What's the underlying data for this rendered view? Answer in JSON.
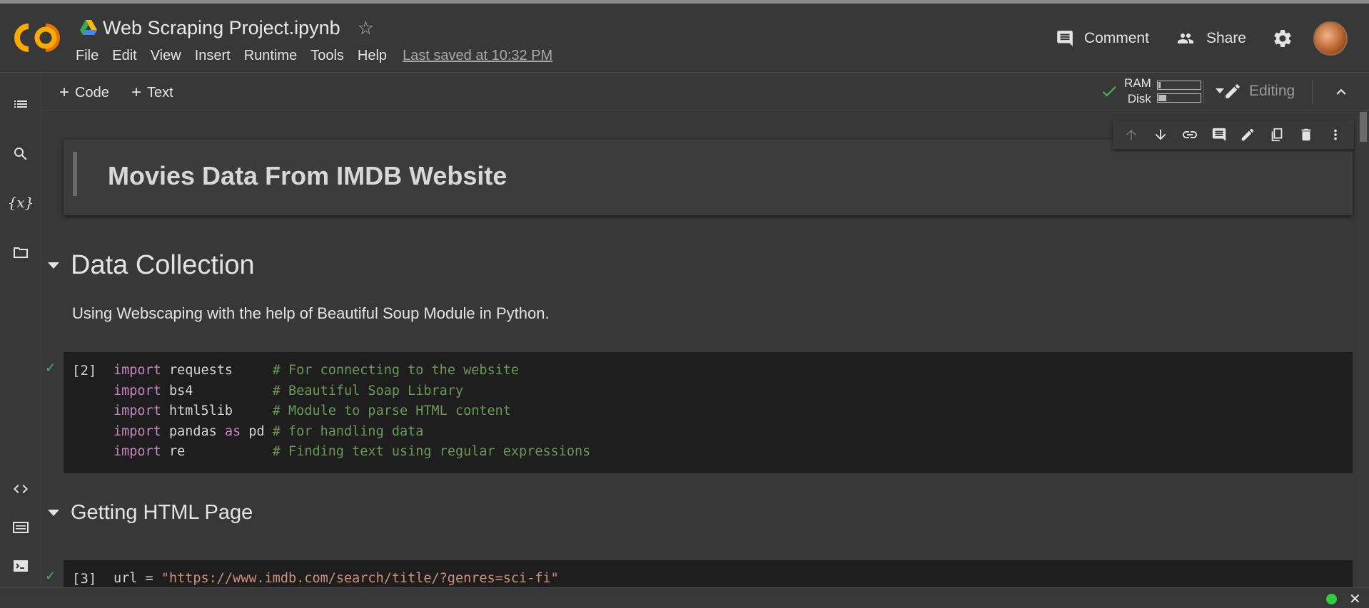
{
  "app": {
    "logo_text": "CO",
    "doc_title": "Web Scraping Project.ipynb",
    "menu": [
      "File",
      "Edit",
      "View",
      "Insert",
      "Runtime",
      "Tools",
      "Help"
    ],
    "last_saved": "Last saved at 10:32 PM"
  },
  "header_actions": {
    "comment_label": "Comment",
    "share_label": "Share"
  },
  "toolbar": {
    "code_label": "Code",
    "text_label": "Text",
    "ram_label": "RAM",
    "disk_label": "Disk",
    "ram_usage": 0.05,
    "disk_usage": 0.18,
    "editing_label": "Editing"
  },
  "rail_icons": [
    "toc-icon",
    "search-icon",
    "variables-icon",
    "folder-icon",
    "code-snippets-icon",
    "command-palette-icon",
    "terminal-icon"
  ],
  "cells": {
    "title": "Movies Data From IMDB Website",
    "section1": "Data Collection",
    "section1_text": "Using Webscaping with the help of Beautiful Soup Module in Python.",
    "cell2_count": "[2]",
    "cell2_lines": [
      {
        "kw": "import",
        "mod": "requests",
        "pad": "     ",
        "comment": "# For connecting to the website"
      },
      {
        "kw": "import",
        "mod": "bs4",
        "pad": "          ",
        "comment": "# Beautiful Soap Library"
      },
      {
        "kw": "import",
        "mod": "html5lib",
        "pad": "     ",
        "comment": "# Module to parse HTML content"
      },
      {
        "kw": "import",
        "mod": "pandas",
        "as_kw": "as",
        "alias": "pd",
        "pad": " ",
        "comment": "# for handling data"
      },
      {
        "kw": "import",
        "mod": "re",
        "pad": "           ",
        "comment": "# Finding text using regular expressions"
      }
    ],
    "section2": "Getting HTML Page",
    "cell3_count": "[3]",
    "cell3_var": "url",
    "cell3_op": " = ",
    "cell3_string": "\"https://www.imdb.com/search/title/?genres=sci-fi\""
  },
  "colors": {
    "background": "#383838",
    "code_background": "#1e1e1e",
    "keyword": "#c586c0",
    "comment": "#6a9955",
    "string": "#ce9178",
    "success": "#4caf50",
    "logo_orange": "#f9ab00"
  }
}
